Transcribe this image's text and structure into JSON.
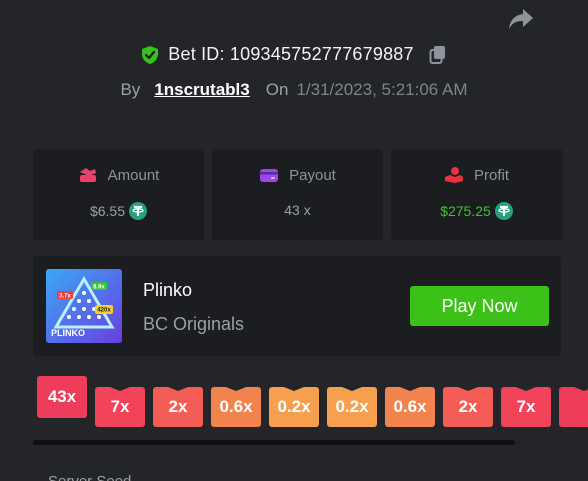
{
  "header": {
    "bet_id_label": "Bet ID: 109345752777679887",
    "by_label": "By",
    "username": "1nscrutabl3",
    "on_label": "On",
    "datetime": "1/31/2023, 5:21:06 AM"
  },
  "stats": {
    "amount": {
      "label": "Amount",
      "value": "$6.55",
      "icon": "amount-icon"
    },
    "payout": {
      "label": "Payout",
      "value": "43 x",
      "icon": "wallet-icon"
    },
    "profit": {
      "label": "Profit",
      "value": "$275.25",
      "icon": "profit-icon"
    }
  },
  "game": {
    "title": "Plinko",
    "subtitle": "BC Originals",
    "play_label": "Play Now",
    "thumbnail_text": "PLINKO",
    "thumbnail_badges": [
      "3.7x",
      "8.9x",
      "420x"
    ]
  },
  "multipliers": [
    {
      "label": "43x",
      "color": "#ee3d5b",
      "active": true
    },
    {
      "label": "7x",
      "color": "#f1435a"
    },
    {
      "label": "2x",
      "color": "#f45d56"
    },
    {
      "label": "0.6x",
      "color": "#f3834e"
    },
    {
      "label": "0.2x",
      "color": "#f6a04f"
    },
    {
      "label": "0.2x",
      "color": "#f6a04f"
    },
    {
      "label": "0.6x",
      "color": "#f3834e"
    },
    {
      "label": "2x",
      "color": "#f45d56"
    },
    {
      "label": "7x",
      "color": "#f1435a"
    },
    {
      "label": "",
      "color": "#ee3d5b"
    }
  ],
  "section": {
    "server_seed_label": "Server Seed"
  },
  "colors": {
    "background": "#232529",
    "card": "#1b1d20",
    "accent_green": "#3bc117",
    "profit_green": "#40c036",
    "usdt": "#26a17b"
  }
}
